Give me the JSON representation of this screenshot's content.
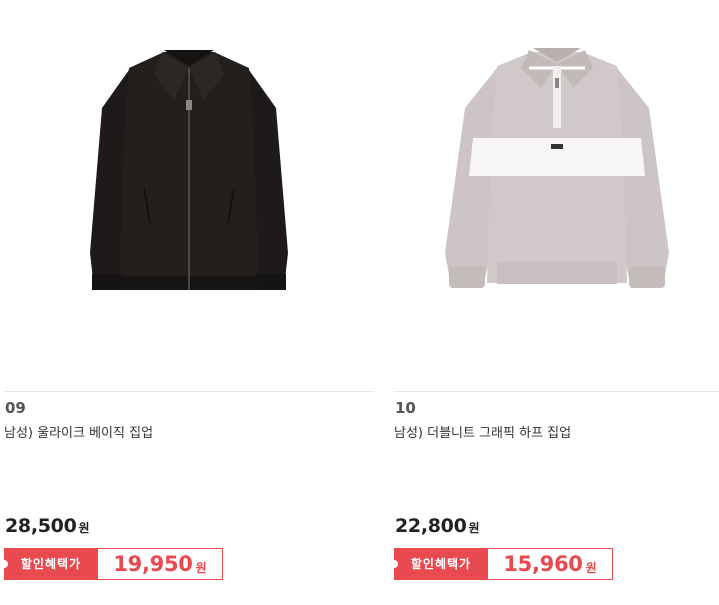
{
  "products": [
    {
      "rank": "09",
      "name": "남성) 울라이크 베이직 집업",
      "price": "28,500",
      "price_unit": "원",
      "discount_label": "할인혜택가",
      "discount_price": "19,950",
      "discount_unit": "원",
      "image_icon": "black-zip-jacket-image"
    },
    {
      "rank": "10",
      "name": "남성) 더블니트 그래픽 하프 집업",
      "price": "22,800",
      "price_unit": "원",
      "discount_label": "할인혜택가",
      "discount_price": "15,960",
      "discount_unit": "원",
      "image_icon": "gray-half-zip-sweatshirt-image"
    }
  ],
  "colors": {
    "accent": "#e84a50",
    "divider": "#e6e6e6"
  }
}
